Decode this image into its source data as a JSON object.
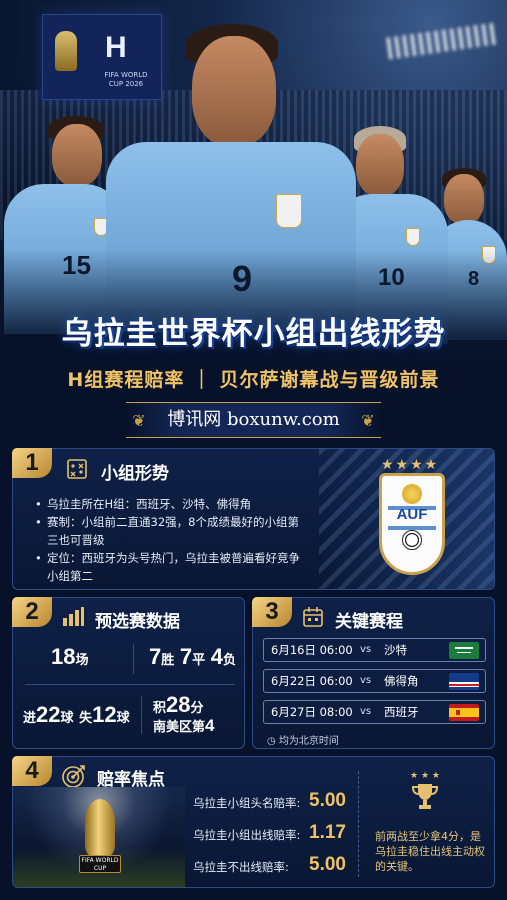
{
  "hero": {
    "banner_letter": "H",
    "banner_text": "FIFA WORLD CUP 2026",
    "title": "乌拉圭世界杯小组出线形势",
    "subtitle": "H组赛程赔率 ｜ 贝尔萨谢幕战与晋级前景",
    "brand": "博讯网 boxunw.com",
    "jersey_numbers": [
      "15",
      "9",
      "10",
      "8"
    ]
  },
  "section1": {
    "badge": "1",
    "title": "小组形势",
    "items": [
      "乌拉圭所在H组：西班牙、沙特、佛得角",
      "赛制：小组前二直通32强，8个成绩最好的小组第三也可晋级",
      "定位：西班牙为头号热门，乌拉圭被普遍看好竞争小组第二"
    ],
    "emblem_text": "AUF"
  },
  "section2": {
    "badge": "2",
    "title": "预选赛数据",
    "matches_num": "18",
    "matches_unit": "场",
    "wins_num": "7",
    "wins_unit": "胜",
    "draws_num": "7",
    "draws_unit": "平",
    "losses_num": "4",
    "losses_unit": "负",
    "goals_for_label": "进",
    "goals_for_num": "22",
    "goals_for_unit": "球",
    "goals_against_label": "失",
    "goals_against_num": "12",
    "goals_against_unit": "球",
    "points_label": "积",
    "points_num": "28",
    "points_unit": "分",
    "rank_label": "南美区第",
    "rank_num": "4"
  },
  "section3": {
    "badge": "3",
    "title": "关键赛程",
    "matches": [
      {
        "datetime": "6月16日 06:00",
        "vs": "vs",
        "opponent": "沙特",
        "flag": "saudi-flag-icon"
      },
      {
        "datetime": "6月22日 06:00",
        "vs": "vs",
        "opponent": "佛得角",
        "flag": "cape-verde-flag-icon"
      },
      {
        "datetime": "6月27日 08:00",
        "vs": "vs",
        "opponent": "西班牙",
        "flag": "spain-flag-icon"
      }
    ],
    "tz_note": "均为北京时间"
  },
  "section4": {
    "badge": "4",
    "title": "赔率焦点",
    "trophy_label": "FIFA WORLD CUP",
    "odds": [
      {
        "label": "乌拉圭小组头名赔率:",
        "value": "5.00"
      },
      {
        "label": "乌拉圭小组出线赔率:",
        "value": "1.17"
      },
      {
        "label": "乌拉圭不出线赔率:",
        "value": "5.00"
      }
    ],
    "note": "前两战至少拿4分，是乌拉圭稳住出线主动权的关键。"
  },
  "colors": {
    "background": "#07122a",
    "gold": "#f0c266",
    "panel_border": "#2d4c85",
    "jersey": "#8ec0ea"
  }
}
